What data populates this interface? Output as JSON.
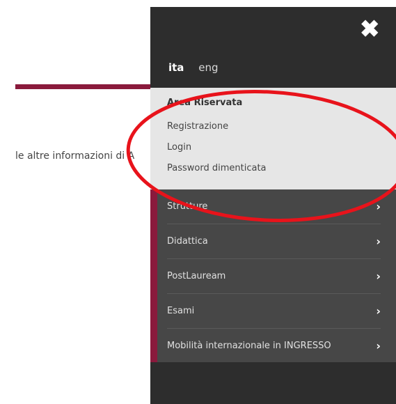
{
  "background": {
    "text": "le altre informazioni di A"
  },
  "drawer": {
    "close_icon": "close-icon",
    "languages": [
      {
        "label": "ita",
        "active": true
      },
      {
        "label": "eng",
        "active": false
      }
    ],
    "area": {
      "title": "Area Riservata",
      "links": [
        "Registrazione",
        "Login",
        "Password dimenticata"
      ]
    },
    "menu": [
      "Strutture",
      "Didattica",
      "PostLauream",
      "Esami",
      "Mobilità internazionale in INGRESSO"
    ]
  },
  "colors": {
    "drawer_bg": "#2d2d2d",
    "area_bg": "#e6e6e6",
    "menu_bg": "#474747",
    "accent": "#8a1a3c",
    "annotation": "#e8131b"
  }
}
